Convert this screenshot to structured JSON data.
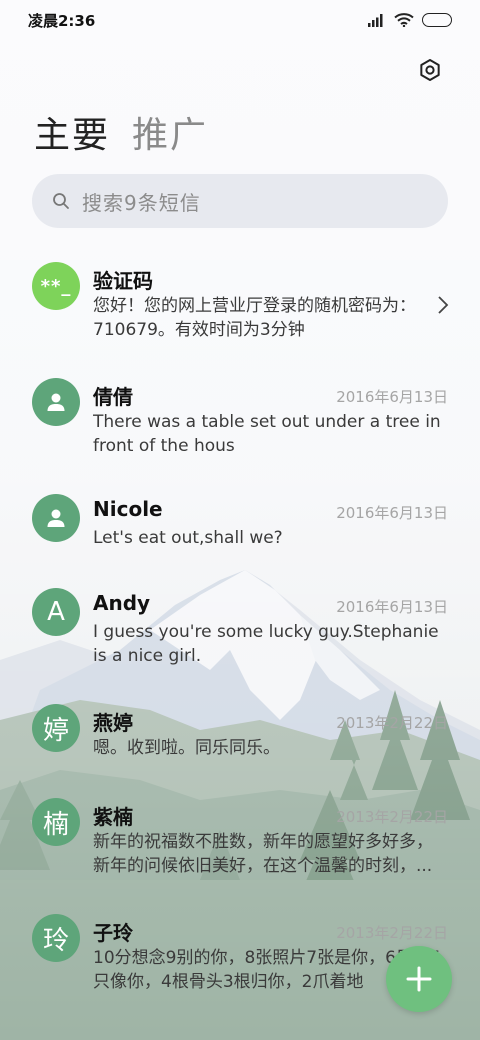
{
  "status_bar": {
    "time": "凌晨2:36"
  },
  "tabs": {
    "primary": "主要",
    "promo": "推广"
  },
  "search": {
    "placeholder": "搜索9条短信"
  },
  "conversations": [
    {
      "avatar": "**_",
      "avatar_color": "#7ed35a",
      "name": "验证码",
      "date": "",
      "preview": "您好！您的网上营业厅登录的随机密码为：710679。有效时间为3分钟"
    },
    {
      "avatar": "person-icon",
      "avatar_color": "#5ea57a",
      "name": "倩倩",
      "date": "2016年6月13日",
      "preview": "There was a table set out under a tree in front of the hous"
    },
    {
      "avatar": "person-icon",
      "avatar_color": "#5ea57a",
      "name": "Nicole",
      "date": "2016年6月13日",
      "preview": "Let's eat out,shall we?"
    },
    {
      "avatar": "A",
      "avatar_color": "#5ea57a",
      "name": "Andy",
      "date": "2016年6月13日",
      "preview": "I guess you're some lucky guy.Stephanie is a nice girl."
    },
    {
      "avatar": "婷",
      "avatar_color": "#5ea57a",
      "name": "燕婷",
      "date": "2013年2月22日",
      "preview": "嗯。收到啦。同乐同乐。"
    },
    {
      "avatar": "楠",
      "avatar_color": "#5ea57a",
      "name": "紫楠",
      "date": "2013年2月22日",
      "preview": "新年的祝福数不胜数，新年的愿望好多好多，新年的问候依旧美好，在这个温馨的时刻，..."
    },
    {
      "avatar": "玲",
      "avatar_color": "#5ea57a",
      "name": "子玲",
      "date": "2013年2月22日",
      "preview": "10分想念9别的你，8张照片7张是你，6只狗5只像你，4根骨头3根归你，2爪着地"
    }
  ],
  "colors": {
    "accent": "#6fc07f",
    "avatar_green": "#5ea57a"
  }
}
